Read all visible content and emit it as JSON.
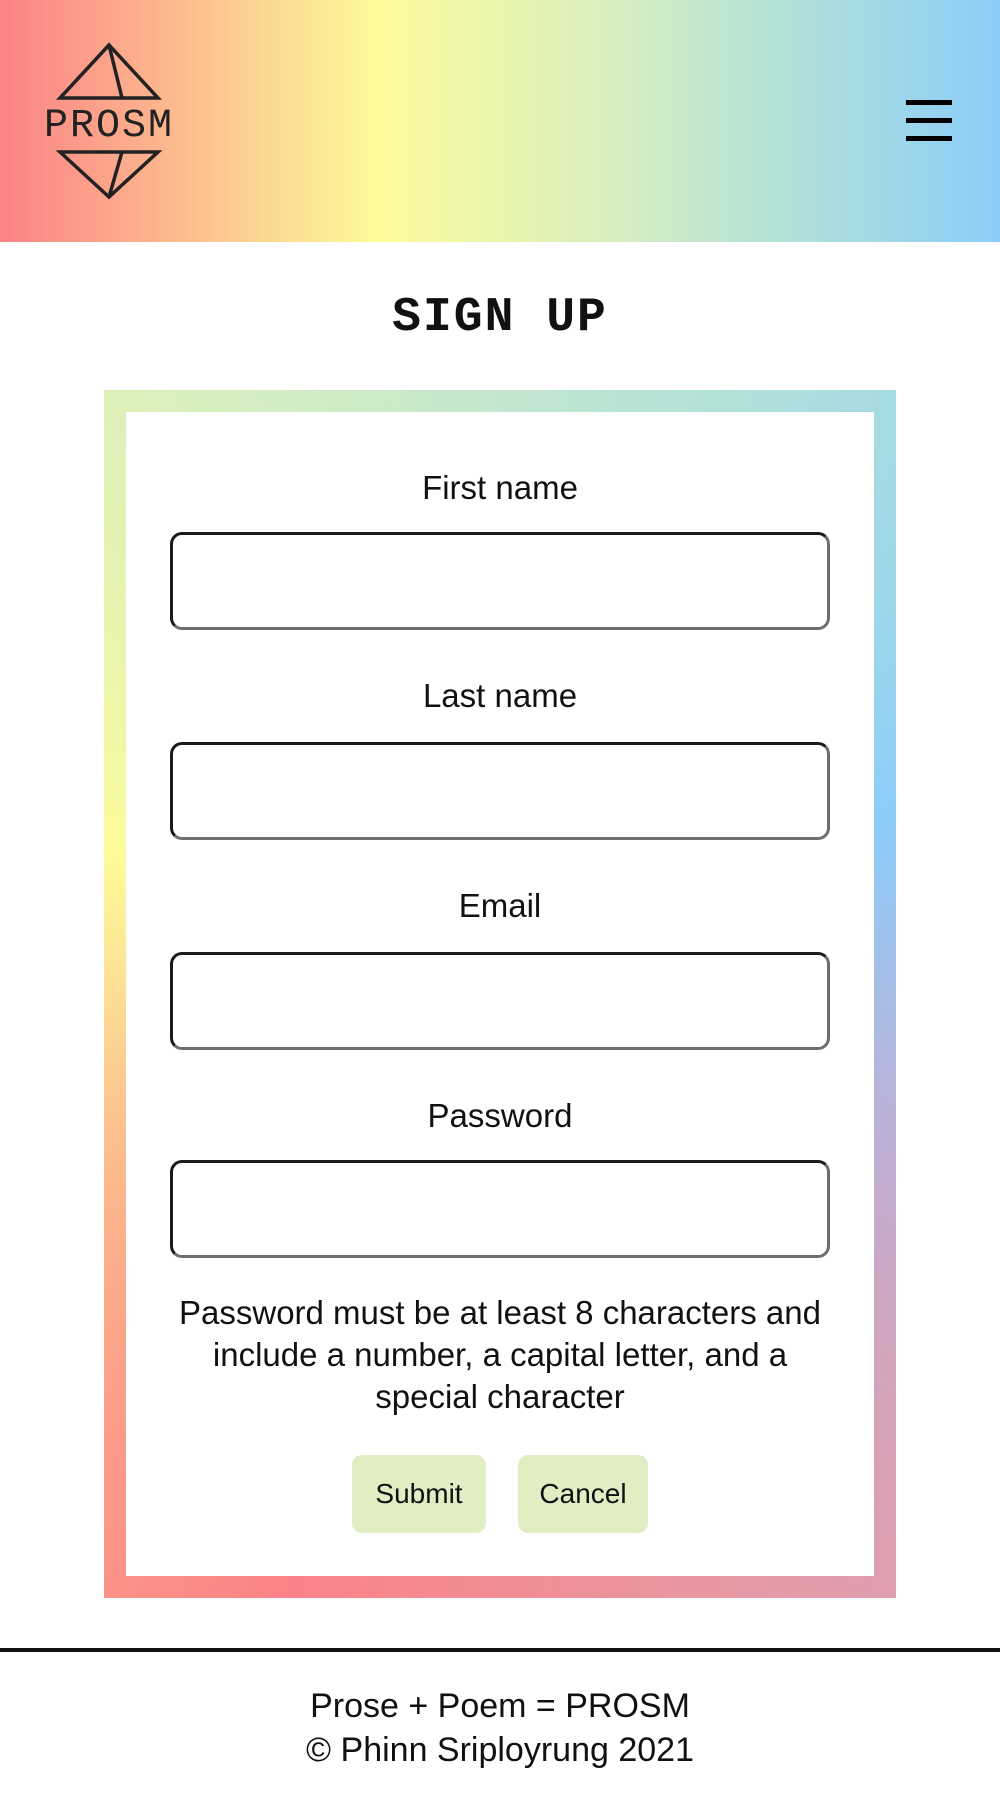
{
  "header": {
    "logo_text": "PROSM",
    "gradient_colors": [
      "#fb8286",
      "#fcc28f",
      "#fdfb9a",
      "#d6eec0",
      "#b2e1d8",
      "#8ccdf9"
    ],
    "menu_icon": "hamburger-menu-icon"
  },
  "page": {
    "title": "SIGN UP"
  },
  "form": {
    "fields": [
      {
        "label": "First name",
        "value": "",
        "placeholder": ""
      },
      {
        "label": "Last name",
        "value": "",
        "placeholder": ""
      },
      {
        "label": "Email",
        "value": "",
        "placeholder": ""
      },
      {
        "label": "Password",
        "value": "",
        "placeholder": ""
      }
    ],
    "password_hint": "Password must be at least 8 characters and include a number, a capital letter, and a special character",
    "submit_label": "Submit",
    "cancel_label": "Cancel",
    "button_color": "#e1edc3"
  },
  "footer": {
    "line1": "Prose + Poem = PROSM",
    "line2": "© Phinn Sriployrung 2021"
  }
}
